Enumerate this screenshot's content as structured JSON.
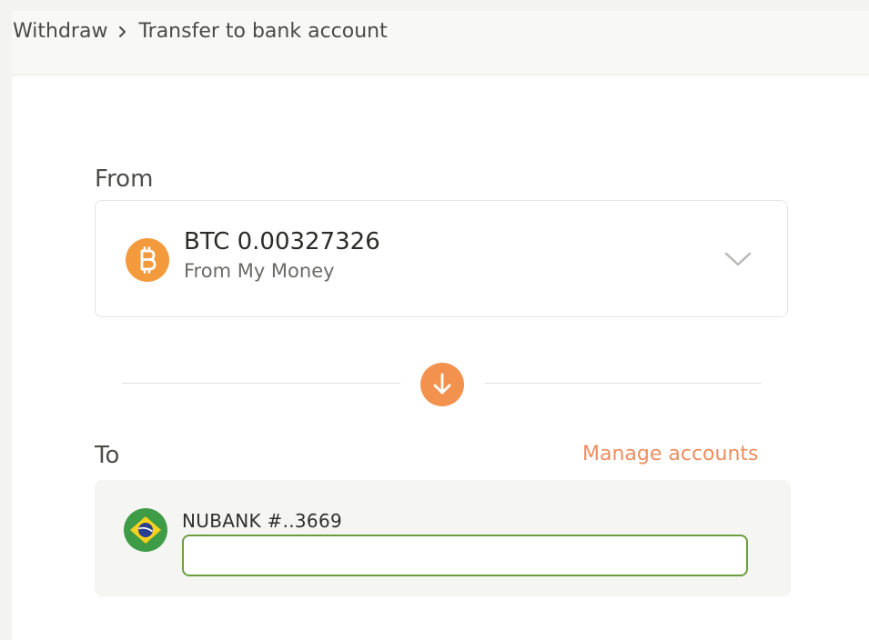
{
  "breadcrumb": {
    "parent": "Withdraw",
    "current": "Transfer to bank account",
    "separator_icon": "chevron-right-icon"
  },
  "from": {
    "label": "From",
    "amount": "BTC 0.00327326",
    "source": "From My Money",
    "coin_icon": "bitcoin-icon",
    "coin_color": "#f39a3c",
    "dropdown_icon": "chevron-down-icon"
  },
  "swap": {
    "icon": "arrow-down-icon",
    "color": "#f3924e"
  },
  "to": {
    "label": "To",
    "manage_link": "Manage accounts",
    "manage_color": "#ec8e5f",
    "bank_name": "NUBANK #..3669",
    "flag_icon": "brazil-flag-icon",
    "input_value": "",
    "input_border_color": "#6a9e3c"
  }
}
